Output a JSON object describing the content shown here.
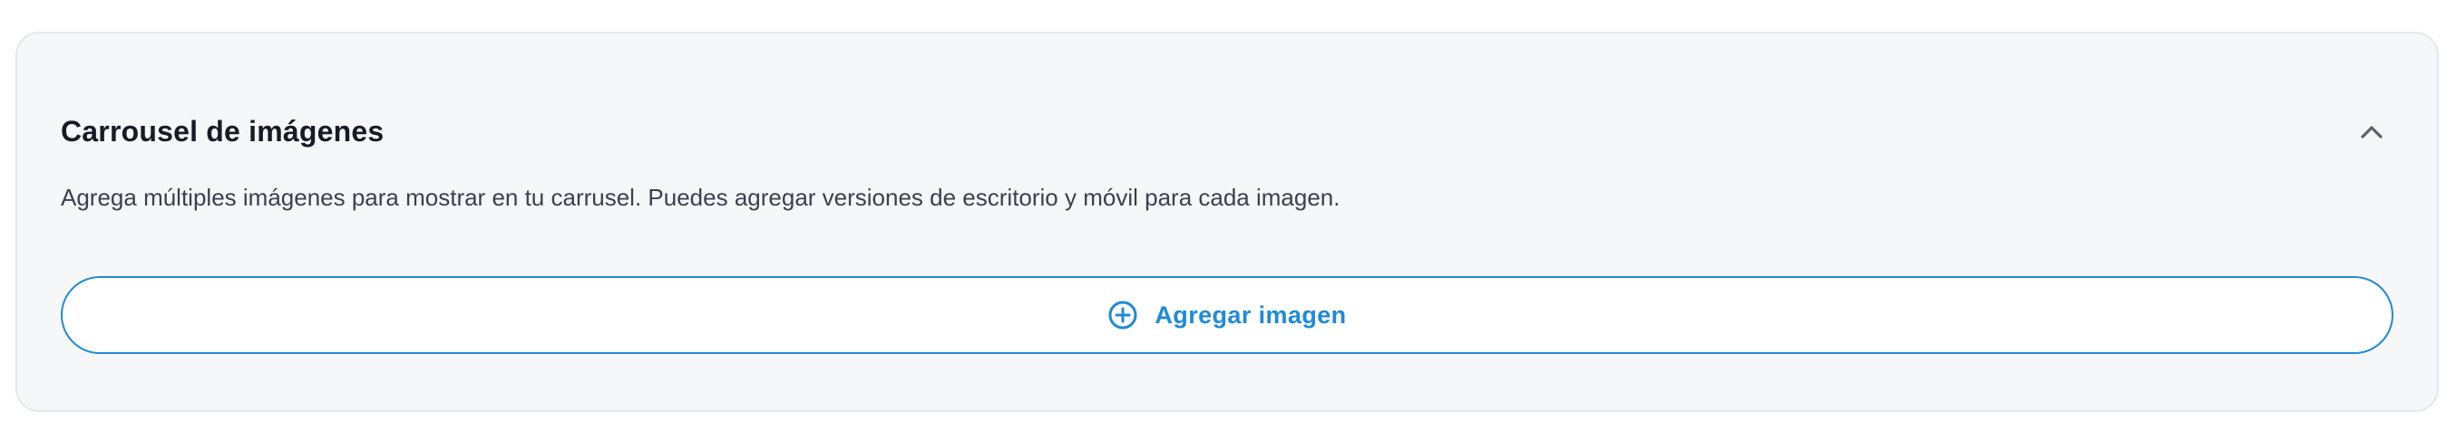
{
  "carousel_section": {
    "title": "Carrousel de imágenes",
    "description": "Agrega múltiples imágenes para mostrar en tu carrusel. Puedes agregar versiones de escritorio y móvil para cada imagen.",
    "add_button_label": "Agregar imagen",
    "collapse_icon": "chevron-up-icon",
    "add_icon": "plus-circle-icon"
  },
  "colors": {
    "accent": "#1f8ad9",
    "card_background": "#f6f7f9",
    "card_border": "#e4e7ec",
    "title_text": "#161b26",
    "body_text": "#3a4150"
  }
}
